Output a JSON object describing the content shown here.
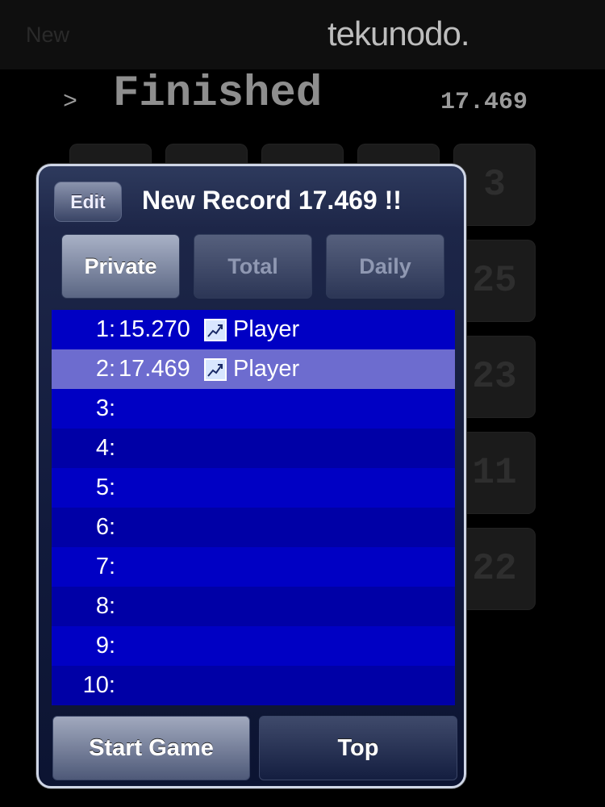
{
  "header": {
    "new_label": "New",
    "brand": "tekunodo."
  },
  "game": {
    "prompt": ">",
    "status": "Finished",
    "timer": "17.469",
    "visible_tiles": [
      "3",
      "25",
      "23",
      "11",
      "22"
    ]
  },
  "dialog": {
    "edit_label": "Edit",
    "title": "New Record 17.469 !!",
    "tabs": [
      "Private",
      "Total",
      "Daily"
    ],
    "active_tab": "Private",
    "entries": [
      {
        "rank": "1:",
        "score": "15.270",
        "player": "Player",
        "has_graph": true
      },
      {
        "rank": "2:",
        "score": "17.469",
        "player": "Player",
        "has_graph": true,
        "selected": true
      },
      {
        "rank": "3:",
        "score": "",
        "player": ""
      },
      {
        "rank": "4:",
        "score": "",
        "player": ""
      },
      {
        "rank": "5:",
        "score": "",
        "player": ""
      },
      {
        "rank": "6:",
        "score": "",
        "player": ""
      },
      {
        "rank": "7:",
        "score": "",
        "player": ""
      },
      {
        "rank": "8:",
        "score": "",
        "player": ""
      },
      {
        "rank": "9:",
        "score": "",
        "player": ""
      },
      {
        "rank": "10:",
        "score": "",
        "player": ""
      }
    ],
    "start_label": "Start Game",
    "top_label": "Top"
  },
  "colors": {
    "list_row": "#0000c4",
    "list_row_alt": "#0000a6",
    "list_row_selected": "#6d6ccf"
  }
}
